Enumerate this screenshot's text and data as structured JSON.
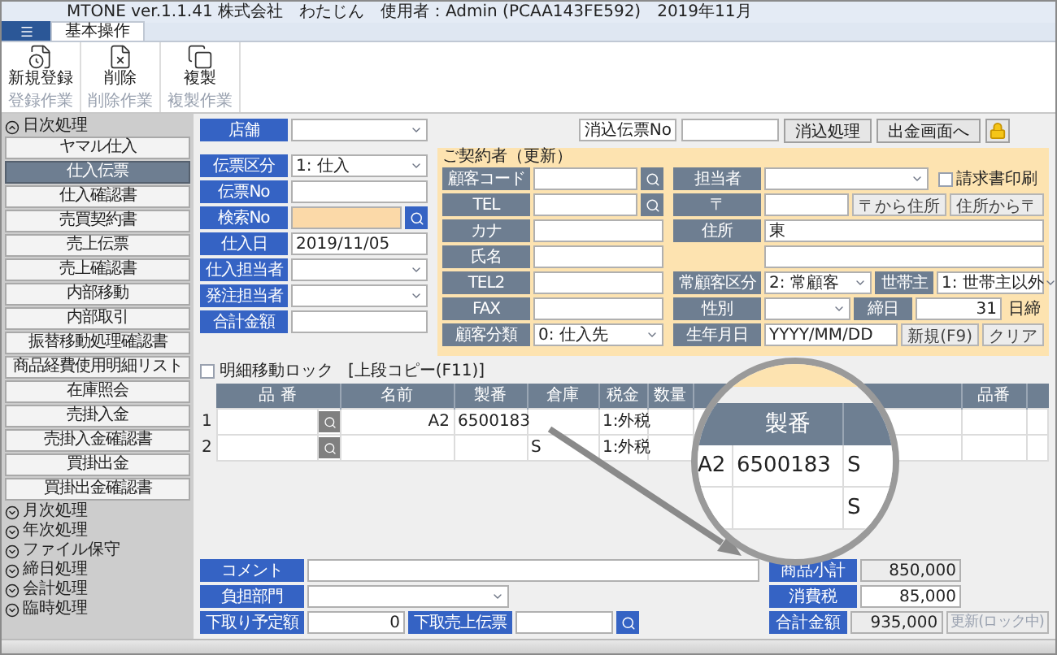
{
  "window": {
    "title": "MTONE ver.1.1.41  株式会社　わたじん　使用者：Admin (PCAA143FE592)　2019年11月"
  },
  "ribbon": {
    "tabs": [
      {
        "label": "基本操作",
        "selected": true
      }
    ],
    "groups": [
      {
        "label": "登録作業",
        "buttons": [
          {
            "label": "新規登録",
            "kind": "new"
          }
        ]
      },
      {
        "label": "削除作業",
        "buttons": [
          {
            "label": "削除",
            "kind": "delete"
          }
        ]
      },
      {
        "label": "複製作業",
        "buttons": [
          {
            "label": "複製",
            "kind": "copy"
          }
        ]
      }
    ]
  },
  "sidebar": {
    "sections": [
      {
        "label": "日次処理",
        "expanded": true,
        "items": [
          {
            "label": "ヤマル仕入",
            "selected": false
          },
          {
            "label": "仕入伝票",
            "selected": true
          },
          {
            "label": "仕入確認書",
            "selected": false
          },
          {
            "label": "売買契約書",
            "selected": false
          },
          {
            "label": "売上伝票",
            "selected": false
          },
          {
            "label": "売上確認書",
            "selected": false
          },
          {
            "label": "内部移動",
            "selected": false
          },
          {
            "label": "内部取引",
            "selected": false
          },
          {
            "label": "振替移動処理確認書",
            "selected": false
          },
          {
            "label": "商品経費使用明細リスト",
            "selected": false
          },
          {
            "label": "在庫照会",
            "selected": false
          },
          {
            "label": "売掛入金",
            "selected": false
          },
          {
            "label": "売掛入金確認書",
            "selected": false
          },
          {
            "label": "買掛出金",
            "selected": false
          },
          {
            "label": "買掛出金確認書",
            "selected": false
          }
        ]
      },
      {
        "label": "月次処理",
        "expanded": false
      },
      {
        "label": "年次処理",
        "expanded": false
      },
      {
        "label": "ファイル保守",
        "expanded": false
      },
      {
        "label": "締日処理",
        "expanded": false
      },
      {
        "label": "会計処理",
        "expanded": false
      },
      {
        "label": "臨時処理",
        "expanded": false
      }
    ]
  },
  "header_form": {
    "fields": [
      {
        "label": "店舗",
        "kind": "select",
        "highlighted": false
      },
      {
        "label": "伝票区分",
        "kind": "select",
        "value": "1: 仕入",
        "highlighted": false
      },
      {
        "label": "伝票No",
        "kind": "text",
        "highlighted": false
      },
      {
        "label": "検索No",
        "kind": "search",
        "highlighted": true
      },
      {
        "label": "仕入日",
        "kind": "text",
        "value": "2019/11/05",
        "highlighted": false
      },
      {
        "label": "仕入担当者",
        "kind": "select",
        "highlighted": false
      },
      {
        "label": "発注担当者",
        "kind": "select",
        "highlighted": false
      },
      {
        "label": "合計金額",
        "kind": "text",
        "highlighted": false
      }
    ]
  },
  "offset": {
    "label": "消込伝票No",
    "buttons": [
      "消込処理",
      "出金画面へ"
    ]
  },
  "contract": {
    "title": "ご契約者（更新）",
    "left_rows": [
      [
        {
          "kind": "label",
          "text": "顧客コード"
        },
        {
          "kind": "text"
        },
        {
          "kind": "search"
        }
      ],
      [
        {
          "kind": "label",
          "text": "TEL"
        },
        {
          "kind": "text"
        },
        {
          "kind": "search"
        }
      ],
      [
        {
          "kind": "label",
          "text": "カナ"
        },
        {
          "kind": "text"
        }
      ],
      [
        {
          "kind": "label",
          "text": "氏名"
        },
        {
          "kind": "text"
        }
      ],
      [
        {
          "kind": "label",
          "text": "TEL2"
        },
        {
          "kind": "text"
        }
      ],
      [
        {
          "kind": "label",
          "text": "FAX"
        },
        {
          "kind": "text"
        }
      ],
      [
        {
          "kind": "label",
          "text": "顧客分類"
        },
        {
          "kind": "select",
          "value": "0: 仕入先"
        }
      ]
    ],
    "right_rows": [
      [
        {
          "kind": "label",
          "text": "担当者"
        },
        {
          "kind": "select"
        },
        {
          "kind": "checkbox",
          "text": "請求書印刷",
          "checked": false
        }
      ],
      [
        {
          "kind": "label",
          "text": "〒"
        },
        {
          "kind": "text"
        },
        {
          "kind": "button",
          "text": "〒から住所",
          "disabled": false
        },
        {
          "kind": "button",
          "text": "住所から〒",
          "disabled": false
        }
      ],
      [
        {
          "kind": "label",
          "text": "住所"
        },
        {
          "kind": "text",
          "value": "東"
        }
      ],
      [
        {
          "kind": "blank"
        },
        {
          "kind": "text"
        }
      ],
      [
        {
          "kind": "label",
          "text": "常顧客区分"
        },
        {
          "kind": "select",
          "value": "2: 常顧客"
        },
        {
          "kind": "label",
          "text": "世帯主"
        },
        {
          "kind": "select",
          "value": "1: 世帯主以外"
        }
      ],
      [
        {
          "kind": "label",
          "text": "性別"
        },
        {
          "kind": "select"
        },
        {
          "kind": "label",
          "text": "締日"
        },
        {
          "kind": "number",
          "value": "31"
        },
        {
          "kind": "note",
          "text": "日締"
        }
      ],
      [
        {
          "kind": "label",
          "text": "生年月日"
        },
        {
          "kind": "text",
          "value": "YYYY/MM/DD"
        },
        {
          "kind": "button",
          "text": "新規(F9)",
          "disabled": false
        },
        {
          "kind": "button",
          "text": "クリア",
          "disabled": false
        }
      ]
    ]
  },
  "detail_lock": {
    "label": "明細移動ロック",
    "checked": false,
    "hint": "[上段コピー(F11)]"
  },
  "table": {
    "columns": [
      "品 番",
      "名前",
      "製番",
      "倉庫",
      "税金",
      "数量",
      "品番"
    ],
    "rows": [
      {
        "no": "1",
        "cells": [
          "",
          "A2",
          "6500183",
          "",
          "1:外税",
          "",
          ""
        ]
      },
      {
        "no": "2",
        "cells": [
          "",
          "",
          "",
          "S",
          "1:外税",
          "",
          ""
        ]
      }
    ]
  },
  "magnifier": {
    "header": "製番",
    "rows": [
      [
        "A2",
        "6500183",
        "S"
      ],
      [
        "",
        "",
        "S"
      ]
    ]
  },
  "footer": {
    "rows": [
      [
        {
          "kind": "label",
          "text": "コメント"
        },
        {
          "kind": "text"
        }
      ],
      [
        {
          "kind": "label",
          "text": "負担部門"
        },
        {
          "kind": "select"
        }
      ],
      [
        {
          "kind": "label",
          "text": "下取り予定額"
        },
        {
          "kind": "number",
          "value": "0"
        },
        {
          "kind": "label",
          "text": "下取売上伝票"
        },
        {
          "kind": "text"
        },
        {
          "kind": "search"
        }
      ]
    ],
    "totals": [
      {
        "label": "商品小計",
        "value": "850,000",
        "readonly": true
      },
      {
        "label": "消費税",
        "value": "85,000",
        "readonly": false
      },
      {
        "label": "合計金額",
        "value": "935,000",
        "readonly": true
      }
    ],
    "update_button": {
      "label": "更新(ロック中)",
      "disabled": true
    }
  }
}
